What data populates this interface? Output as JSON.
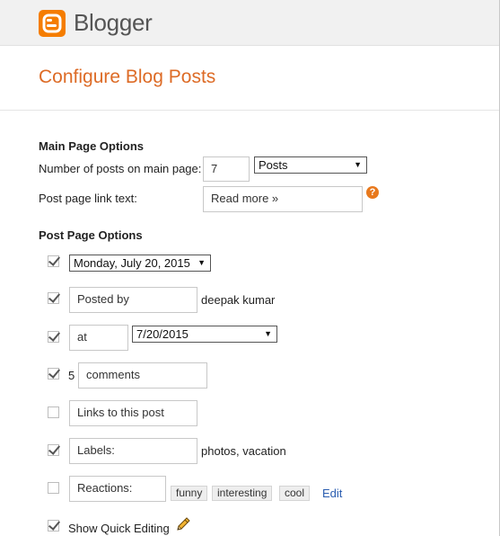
{
  "header": {
    "brand": "Blogger"
  },
  "page": {
    "title": "Configure Blog Posts"
  },
  "main_options": {
    "heading": "Main Page Options",
    "num_posts_label": "Number of posts on main page:",
    "num_posts_value": "7",
    "num_posts_unit": "Posts",
    "link_text_label": "Post page link text:",
    "link_text_value": "Read more »",
    "help_icon": "?"
  },
  "post_options": {
    "heading": "Post Page Options",
    "date": {
      "checked": true,
      "value": "Monday, July 20, 2015"
    },
    "posted_by": {
      "checked": true,
      "label": "Posted by",
      "author": "deepak kumar"
    },
    "time": {
      "checked": true,
      "label": "at",
      "value": "7/20/2015"
    },
    "comments": {
      "checked": true,
      "count": "5",
      "label": "comments"
    },
    "links": {
      "checked": false,
      "label": "Links to this post"
    },
    "labels": {
      "checked": true,
      "label": "Labels:",
      "values": "photos, vacation"
    },
    "reactions": {
      "checked": false,
      "label": "Reactions:",
      "chips": [
        "funny",
        "interesting",
        "cool"
      ],
      "edit": "Edit"
    },
    "quick_edit": {
      "checked": true,
      "label": "Show Quick Editing"
    }
  },
  "colors": {
    "brand_orange": "#f57d00",
    "title_orange": "#dd6b26",
    "link_blue": "#2a5db0"
  },
  "icons": {
    "logo": "blogger-logo-icon",
    "help": "help-icon",
    "pencil": "pencil-icon",
    "dropdown": "chevron-down-icon"
  }
}
